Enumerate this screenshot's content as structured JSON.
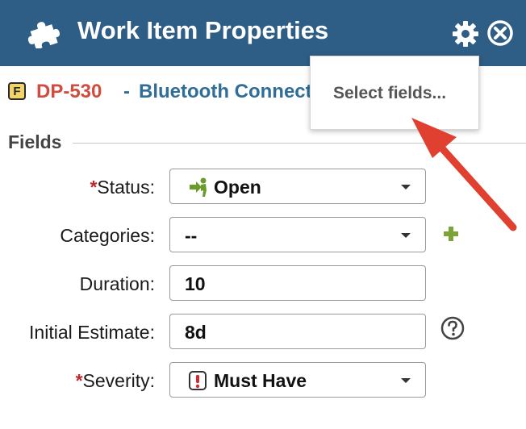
{
  "header": {
    "title": "Work Item Properties",
    "icons": [
      "puzzle-icon",
      "gear-icon",
      "close-circle-icon"
    ],
    "background": "#2e5d86"
  },
  "work_item": {
    "type_badge": "F",
    "id": "DP-530",
    "separator": "-",
    "name": "Bluetooth Connectivity"
  },
  "settings_menu": {
    "items": [
      "Select fields..."
    ]
  },
  "fields_section": {
    "title": "Fields"
  },
  "fields": {
    "status": {
      "required_mark": "*",
      "label": "Status:",
      "value": "Open",
      "icon": "open-status-icon"
    },
    "categories": {
      "label": "Categories:",
      "value": "--",
      "side_icon": "add-icon"
    },
    "duration": {
      "label": "Duration:",
      "value": "10"
    },
    "initial_estimate": {
      "label": "Initial Estimate:",
      "value": "8d",
      "side_icon": "help-icon"
    },
    "severity": {
      "required_mark": "*",
      "label": "Severity:",
      "value": "Must Have",
      "icon": "must-have-icon"
    }
  },
  "colors": {
    "item_id": "#d24b3f",
    "item_name": "#2f6e97",
    "required": "#c0272d",
    "add_icon": "#7aa33a",
    "arrow": "#e0402f"
  }
}
